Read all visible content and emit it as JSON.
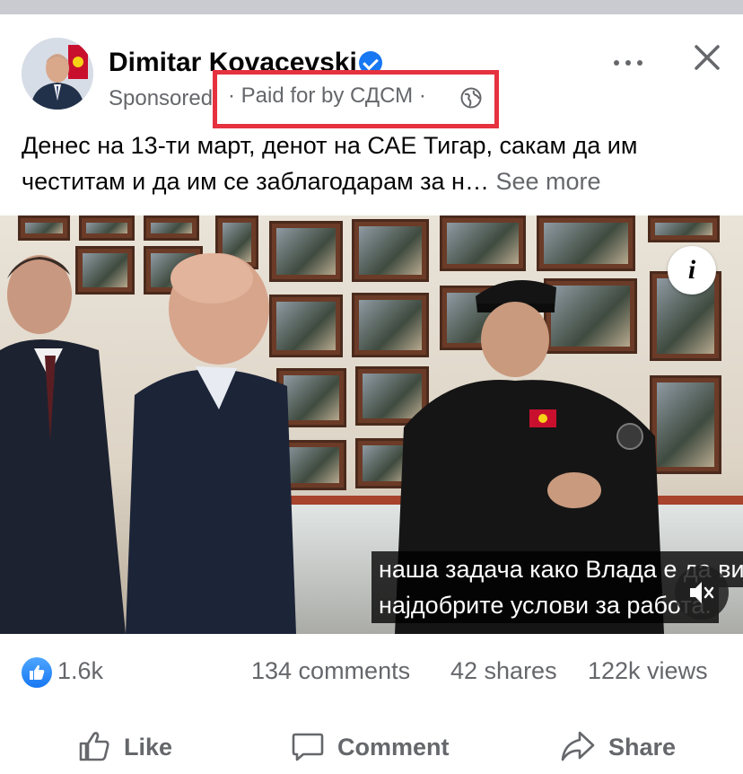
{
  "post": {
    "author": "Dimitar Kovacevski",
    "sponsored": "Sponsored",
    "paid_for": "· Paid for by СДСМ ·",
    "text": "Денес на 13-ти март, денот на САЕ Тигар, сакам да им честитам и да им се заблагодарам за н…",
    "see_more": "See more"
  },
  "video": {
    "caption_line1": "наша задача како Влада е да ви ги обезбедиме",
    "caption_line2": "најдобрите услови за работа.",
    "info_label": "i"
  },
  "stats": {
    "likes": "1.6k",
    "comments": "134 comments",
    "shares": "42 shares",
    "views": "122k views"
  },
  "actions": {
    "like": "Like",
    "comment": "Comment",
    "share": "Share"
  },
  "colors": {
    "accent": "#1877f2",
    "highlight": "#e5323e",
    "secondary_text": "#65676b"
  },
  "icons": [
    "verified-icon",
    "globe-icon",
    "more-icon",
    "close-icon",
    "info-icon",
    "mute-icon",
    "like-reaction-icon",
    "thumbs-up-icon",
    "comment-icon",
    "share-icon"
  ]
}
